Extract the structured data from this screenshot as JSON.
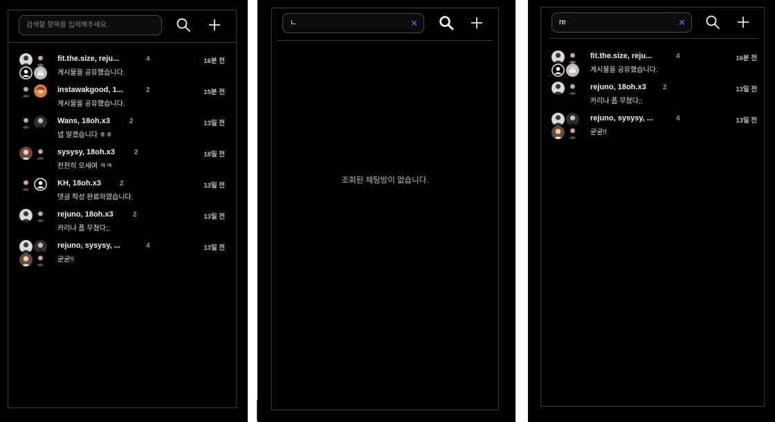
{
  "icons": {
    "search": "search-icon",
    "add": "plus-icon",
    "clear": "close-icon"
  },
  "colors": {
    "background": "#000000",
    "border": "#3a3a3a",
    "clear_accent": "#4b7bff"
  },
  "panel_default": {
    "search": {
      "value": "",
      "placeholder": "검색할 항목을 입력해주세요."
    },
    "chats": [
      {
        "name": "fit.the.size, reju...",
        "count": "4",
        "time": "16분 전",
        "message": "게시물을 공유했습니다."
      },
      {
        "name": "instawakgood, 1...",
        "count": "2",
        "time": "15분 전",
        "message": "게시물을 공유했습니다."
      },
      {
        "name": "Wans, 18oh.x3",
        "count": "2",
        "time": "13일 전",
        "message": "넵 알겠습니다 ㅎㅎ"
      },
      {
        "name": "sysysy, 18oh.x3",
        "count": "2",
        "time": "18일 전",
        "message": "천천히 오세여 ㅋㅋ"
      },
      {
        "name": "KH, 18oh.x3",
        "count": "2",
        "time": "13일 전",
        "message": "댓글 작성 완료하였습니다."
      },
      {
        "name": "rejuno, 18oh.x3",
        "count": "2",
        "time": "13일 전",
        "message": "카리나 폼 무쳤다;;"
      },
      {
        "name": "rejuno, sysysy, ...",
        "count": "4",
        "time": "13일 전",
        "message": "굳굳!!"
      }
    ]
  },
  "panel_empty": {
    "search": {
      "value": "ㄴ"
    },
    "empty_message": "조회된 채팅방이 없습니다."
  },
  "panel_filtered": {
    "search": {
      "value": "re"
    },
    "chats": [
      {
        "name": "fit.the.size, reju...",
        "count": "4",
        "time": "16분 전",
        "message": "게시물을 공유했습니다."
      },
      {
        "name": "rejuno, 18oh.x3",
        "count": "2",
        "time": "13일 전",
        "message": "카리나 폼 무쳤다;;"
      },
      {
        "name": "rejuno, sysysy, ...",
        "count": "4",
        "time": "13일 전",
        "message": "굳굳!!"
      }
    ]
  }
}
